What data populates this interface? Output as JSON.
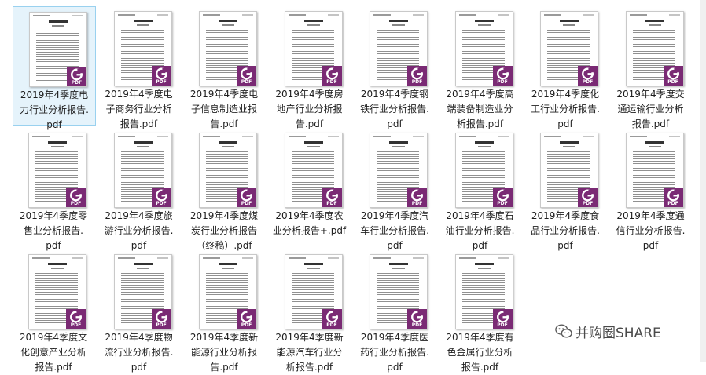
{
  "badge_label": "PDF",
  "watermark": {
    "text": "并购圈SHARE"
  },
  "colors": {
    "selection_bg": "#e5f3fb",
    "selection_border": "#99d1ef",
    "badge": "#7a2a74",
    "badge_logo": "#ffffff"
  },
  "files": [
    {
      "name": "2019年4季度电力行业分析报告.pdf",
      "label": "2019年4季度电\n力行业分析报告.\npdf",
      "selected": true
    },
    {
      "name": "2019年4季度电子商务行业分析报告.pdf",
      "label": "2019年4季度电\n子商务行业分析\n报告.pdf",
      "selected": false
    },
    {
      "name": "2019年4季度电子信息制造业报告.pdf",
      "label": "2019年4季度电\n子信息制造业报\n告.pdf",
      "selected": false
    },
    {
      "name": "2019年4季度房地产行业分析报告.pdf",
      "label": "2019年4季度房\n地产行业分析报\n告.pdf",
      "selected": false
    },
    {
      "name": "2019年4季度钢铁行业分析报告.pdf",
      "label": "2019年4季度钢\n铁行业分析报告.\npdf",
      "selected": false
    },
    {
      "name": "2019年4季度高端装备制造业分析报告.pdf",
      "label": "2019年4季度高\n端装备制造业分\n析报告.pdf",
      "selected": false
    },
    {
      "name": "2019年4季度化工行业分析报告.pdf",
      "label": "2019年4季度化\n工行业分析报告.\npdf",
      "selected": false
    },
    {
      "name": "2019年4季度交通运输行业分析报告.pdf",
      "label": "2019年4季度交\n通运输行业分析\n报告.pdf",
      "selected": false
    },
    {
      "name": "2019年4季度零售业分析报告.pdf",
      "label": "2019年4季度零\n售业分析报告.\npdf",
      "selected": false
    },
    {
      "name": "2019年4季度旅游行业分析报告.pdf",
      "label": "2019年4季度旅\n游行业分析报告.\npdf",
      "selected": false
    },
    {
      "name": "2019年4季度煤炭行业分析报告（终稿）.pdf",
      "label": "2019年4季度煤\n炭行业分析报告\n（终稿）.pdf",
      "selected": false
    },
    {
      "name": "2019年4季度农业分析报告+.pdf",
      "label": "2019年4季度农\n业分析报告+.pdf",
      "selected": false
    },
    {
      "name": "2019年4季度汽车行业分析报告.pdf",
      "label": "2019年4季度汽\n车行业分析报告.\npdf",
      "selected": false
    },
    {
      "name": "2019年4季度石油行业分析报告.pdf",
      "label": "2019年4季度石\n油行业分析报告.\npdf",
      "selected": false
    },
    {
      "name": "2019年4季度食品行业分析报告.pdf",
      "label": "2019年4季度食\n品行业分析报告.\npdf",
      "selected": false
    },
    {
      "name": "2019年4季度通信行业分析报告.pdf",
      "label": "2019年4季度通\n信行业分析报告.\npdf",
      "selected": false
    },
    {
      "name": "2019年4季度文化创意产业分析报告.pdf",
      "label": "2019年4季度文\n化创意产业分析\n报告.pdf",
      "selected": false
    },
    {
      "name": "2019年4季度物流行业分析报告.pdf",
      "label": "2019年4季度物\n流行业分析报告.\npdf",
      "selected": false
    },
    {
      "name": "2019年4季度新能源行业分析报告.pdf",
      "label": "2019年4季度新\n能源行业分析报\n告.pdf",
      "selected": false
    },
    {
      "name": "2019年4季度新能源汽车行业分析报告.pdf",
      "label": "2019年4季度新\n能源汽车行业分\n析报告.pdf",
      "selected": false
    },
    {
      "name": "2019年4季度医药行业分析报告.pdf",
      "label": "2019年4季度医\n药行业分析报告.\npdf",
      "selected": false
    },
    {
      "name": "2019年4季度有色金属行业分析报告.pdf",
      "label": "2019年4季度有\n色金属行业分析\n报告.pdf",
      "selected": false
    }
  ]
}
